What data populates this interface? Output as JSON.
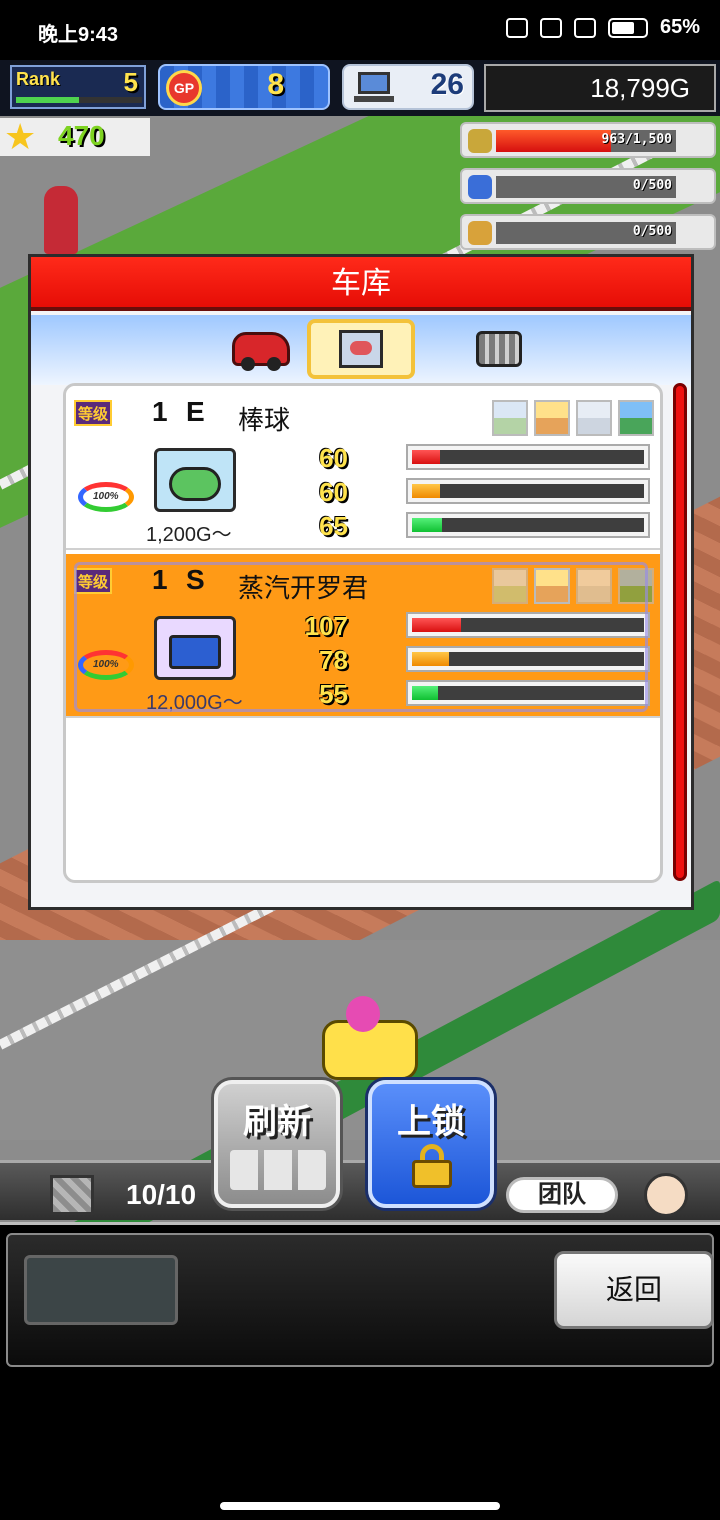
{
  "status_bar": {
    "time": "晚上9:43",
    "battery": "65%"
  },
  "hud": {
    "rank_label": "Rank",
    "rank_value": "5",
    "rank_progress": 0.5,
    "gp_label": "GP",
    "gp_value": "8",
    "pc_value": "26",
    "money": "18,799G",
    "stars": "470"
  },
  "resources": [
    {
      "icon": "coin-icon",
      "value": "963/1,500",
      "fill": 0.64
    },
    {
      "icon": "fuel-icon",
      "value": "0/500",
      "fill": 0
    },
    {
      "icon": "wheat-icon",
      "value": "0/500",
      "fill": 0
    }
  ],
  "garage": {
    "title": "车库",
    "tabs": [
      {
        "name": "car-tab",
        "icon": "car-icon",
        "active": false
      },
      {
        "name": "kit-tab",
        "icon": "kit-box-icon",
        "active": true
      },
      {
        "name": "engine-tab",
        "icon": "engine-icon",
        "active": false
      }
    ],
    "items": [
      {
        "grade_label": "等级",
        "grade_num": "1",
        "grade_letter": "E",
        "name": "棒球",
        "price": "1,200G～",
        "badge_pct": "100%",
        "stats": [
          {
            "value": "60",
            "fill": 0.12,
            "color": "red"
          },
          {
            "value": "60",
            "fill": 0.12,
            "color": "orange"
          },
          {
            "value": "65",
            "fill": 0.13,
            "color": "green"
          }
        ],
        "selected": false
      },
      {
        "grade_label": "等级",
        "grade_num": "1",
        "grade_letter": "S",
        "name": "蒸汽开罗君",
        "price": "12,000G～",
        "badge_pct": "100%",
        "stats": [
          {
            "value": "107",
            "fill": 0.21,
            "color": "red"
          },
          {
            "value": "78",
            "fill": 0.16,
            "color": "orange"
          },
          {
            "value": "55",
            "fill": 0.11,
            "color": "green"
          }
        ],
        "selected": true
      }
    ]
  },
  "controls": {
    "refresh_label": "刷新",
    "lock_label": "上锁",
    "tool_count": "10/10",
    "team_label": "团队",
    "back_label": "返回"
  },
  "colors": {
    "title_red": "#ff2a1a",
    "selected_orange": "#ff9a16",
    "lock_blue": "#2c66e6"
  }
}
